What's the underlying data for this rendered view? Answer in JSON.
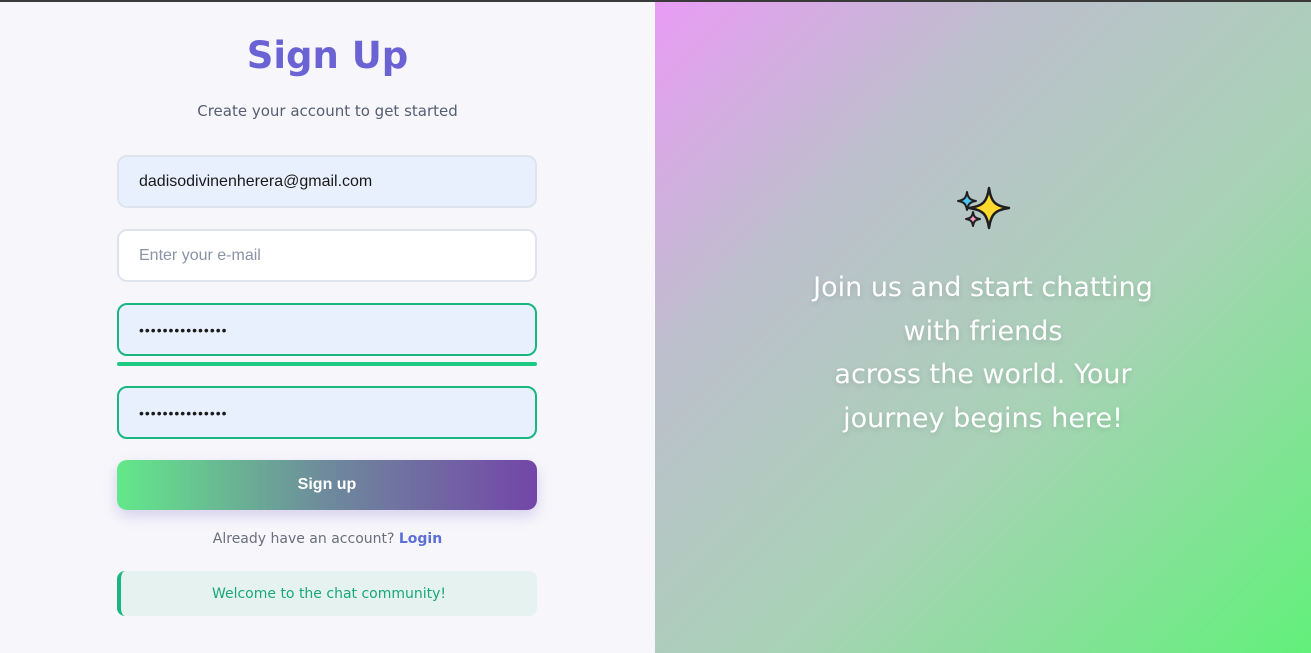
{
  "signup": {
    "title": "Sign Up",
    "subtitle": "Create your account to get started",
    "username_value": "dadisodivinenherera@gmail.com",
    "email_placeholder": "Enter your e-mail",
    "password_value": "•••••••••••••••",
    "password_strength": 1.0,
    "confirm_password_value": "•••••••••••••••",
    "submit_label": "Sign up",
    "login_prompt": "Already have an account?",
    "login_link": "Login",
    "notice": "Welcome to the chat community!"
  },
  "hero": {
    "icon": "sparkles-icon",
    "tagline_line1": "Join us and start chatting",
    "tagline_line2": "with friends",
    "tagline_line3": "across the world. Your",
    "tagline_line4": "journey begins here!"
  },
  "colors": {
    "accent": "#6b63d4",
    "success": "#19b77f",
    "link": "#5d6fd8"
  }
}
